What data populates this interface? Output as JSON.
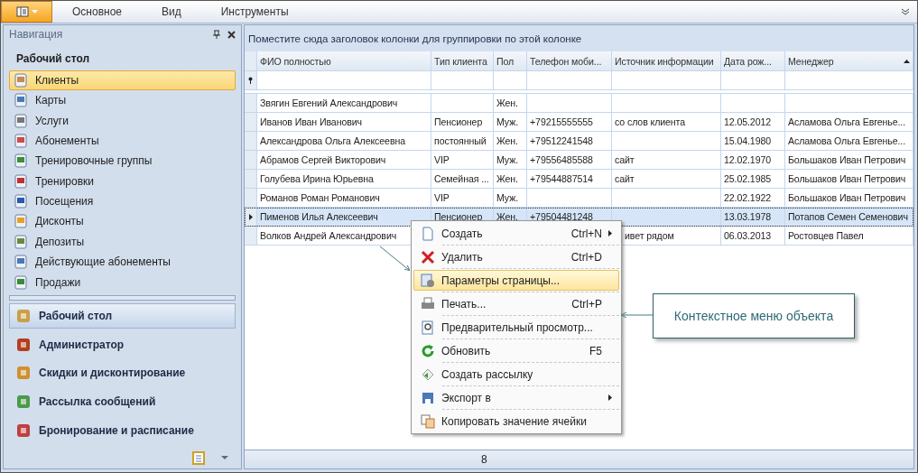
{
  "ribbon": {
    "tabs": [
      {
        "label": "Основное",
        "selected": false
      },
      {
        "label": "Вид",
        "selected": false
      },
      {
        "label": "Инструменты",
        "selected": false
      }
    ]
  },
  "navigation": {
    "title": "Навигация",
    "group_title": "Рабочий стол",
    "items": [
      {
        "label": "Клиенты",
        "selected": true
      },
      {
        "label": "Карты",
        "selected": false
      },
      {
        "label": "Услуги",
        "selected": false
      },
      {
        "label": "Абонементы",
        "selected": false
      },
      {
        "label": "Тренировочные группы",
        "selected": false
      },
      {
        "label": "Тренировки",
        "selected": false
      },
      {
        "label": "Посещения",
        "selected": false
      },
      {
        "label": "Дисконты",
        "selected": false
      },
      {
        "label": "Депозиты",
        "selected": false
      },
      {
        "label": "Действующие абонементы",
        "selected": false
      },
      {
        "label": "Продажи",
        "selected": false
      }
    ],
    "groups": [
      {
        "label": "Рабочий стол",
        "selected": true
      },
      {
        "label": "Администратор",
        "selected": false
      },
      {
        "label": "Скидки и дисконтирование",
        "selected": false
      },
      {
        "label": "Рассылка сообщений",
        "selected": false
      },
      {
        "label": "Бронирование и расписание",
        "selected": false
      }
    ]
  },
  "grid": {
    "group_panel": "Поместите сюда заголовок колонки для группировки по этой колонке",
    "columns": [
      "ФИО полностью",
      "Тип клиента",
      "Пол",
      "Телефон моби...",
      "Источник информации",
      "Дата рож...",
      "Менеджер"
    ],
    "rows": [
      {
        "selected": false,
        "cells": [
          "Звягин Евгений Александрович",
          "",
          "Жен.",
          "",
          "",
          "",
          ""
        ]
      },
      {
        "selected": false,
        "cells": [
          "Иванов Иван Иванович",
          "Пенсионер",
          "Муж.",
          "+79215555555",
          "со слов клиента",
          "12.05.2012",
          "Асламова Ольга Евгенье..."
        ]
      },
      {
        "selected": false,
        "cells": [
          "Александрова Ольга Алексеевна",
          "постоянный",
          "Жен.",
          "+79512241548",
          "",
          "15.04.1980",
          "Асламова Ольга Евгенье..."
        ]
      },
      {
        "selected": false,
        "cells": [
          "Абрамов Сергей Викторович",
          "VIP",
          "Муж.",
          "+79556485588",
          "сайт",
          "12.02.1970",
          "Большаков Иван Петрович"
        ]
      },
      {
        "selected": false,
        "cells": [
          "Голубева Ирина Юрьевна",
          "Семейная ...",
          "Жен.",
          "+79544887514",
          "сайт",
          "25.02.1985",
          "Большаков Иван Петрович"
        ]
      },
      {
        "selected": false,
        "cells": [
          "Романов Роман Романович",
          "VIP",
          "Муж.",
          "",
          "",
          "22.02.1922",
          "Большаков Иван Петрович"
        ]
      },
      {
        "selected": true,
        "cells": [
          "Пименов Илья Алексеевич",
          "Пенсионер",
          "Жен.",
          "+79504481248",
          "",
          "13.03.1978",
          "Потапов Семен Семенович"
        ]
      },
      {
        "selected": false,
        "cells": [
          "Волков Андрей Александрович",
          "",
          "",
          "",
          "ивет рядом",
          "06.03.2013",
          "Ростовцев Павел"
        ]
      }
    ],
    "footer": "8"
  },
  "context_menu": [
    {
      "label": "Создать",
      "shortcut": "Ctrl+N",
      "submenu": true,
      "selected": false
    },
    {
      "label": "Удалить",
      "shortcut": "Ctrl+D",
      "submenu": false,
      "selected": false
    },
    {
      "label": "Параметры страницы...",
      "submenu": false,
      "selected": true
    },
    {
      "label": "Печать...",
      "shortcut": "Ctrl+P",
      "submenu": false,
      "selected": false
    },
    {
      "label": "Предварительный просмотр...",
      "submenu": false,
      "selected": false
    },
    {
      "label": "Обновить",
      "shortcut": "F5",
      "submenu": false,
      "selected": false
    },
    {
      "label": "Создать рассылку",
      "submenu": false,
      "selected": false
    },
    {
      "label": "Экспорт в",
      "submenu": true,
      "selected": false
    },
    {
      "label": "Копировать значение ячейки",
      "submenu": false,
      "selected": false
    }
  ],
  "callout": "Контекстное меню объекта"
}
